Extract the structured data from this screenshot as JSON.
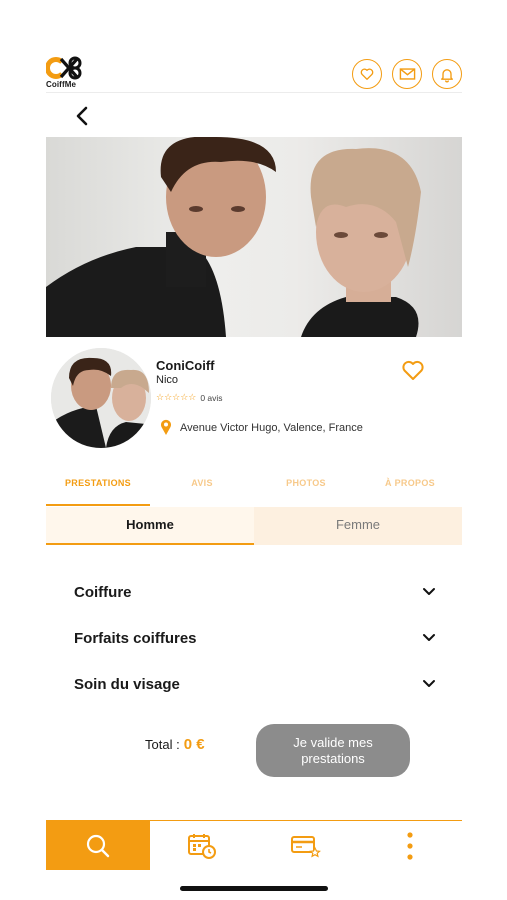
{
  "header": {
    "logo_text": "CoiffMe",
    "icons": [
      "heart-icon",
      "mail-icon",
      "bell-icon"
    ],
    "back_icon": "chevron-left-icon"
  },
  "salon": {
    "name": "ConiCoiff",
    "owner": "Nico",
    "stars": "☆☆☆☆☆",
    "reviews": "0 avis",
    "address": "Avenue Victor Hugo, Valence, France"
  },
  "tabs": [
    {
      "label": "PRESTATIONS",
      "active": true
    },
    {
      "label": "AVIS",
      "active": false
    },
    {
      "label": "PHOTOS",
      "active": false
    },
    {
      "label": "À PROPOS",
      "active": false
    }
  ],
  "gender": {
    "options": [
      {
        "label": "Homme",
        "active": true
      },
      {
        "label": "Femme",
        "active": false
      }
    ]
  },
  "categories": [
    {
      "label": "Coiffure"
    },
    {
      "label": "Forfaits coiffures"
    },
    {
      "label": "Soin du visage"
    }
  ],
  "footer": {
    "total_label": "Total :",
    "total_value": "0 €",
    "validate_label": "Je valide mes prestations"
  },
  "bottom_nav": {
    "items": [
      "search-icon",
      "calendar-clock-icon",
      "card-star-icon",
      "more-vertical-icon"
    ]
  },
  "colors": {
    "accent": "#f39c12",
    "accent_light": "#fdf0e0",
    "button_disabled": "#8c8c8c"
  }
}
